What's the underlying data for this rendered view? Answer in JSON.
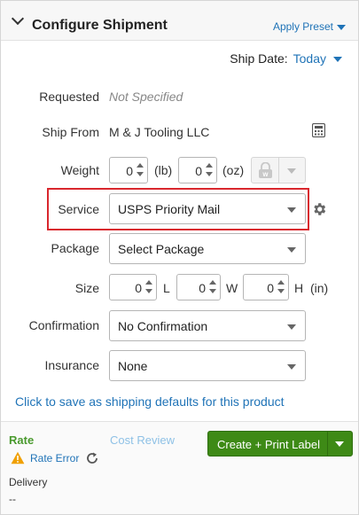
{
  "header": {
    "title": "Configure Shipment",
    "apply_preset": "Apply Preset"
  },
  "ship_date": {
    "label": "Ship Date:",
    "value": "Today"
  },
  "form": {
    "requested": {
      "label": "Requested",
      "value": "Not Specified"
    },
    "ship_from": {
      "label": "Ship From",
      "value": "M & J Tooling LLC",
      "icon": "calculator-icon"
    },
    "weight": {
      "label": "Weight",
      "lb": "0",
      "lb_unit": "(lb)",
      "oz": "0",
      "oz_unit": "(oz)",
      "scale_icon": "scale-lock-icon"
    },
    "service": {
      "label": "Service",
      "value": "USPS Priority Mail",
      "icon": "gear-icon"
    },
    "package": {
      "label": "Package",
      "value": "Select Package"
    },
    "size": {
      "label": "Size",
      "l": "0",
      "l_label": "L",
      "w": "0",
      "w_label": "W",
      "h": "0",
      "h_label": "H",
      "unit": "(in)"
    },
    "confirmation": {
      "label": "Confirmation",
      "value": "No Confirmation"
    },
    "insurance": {
      "label": "Insurance",
      "value": "None"
    }
  },
  "defaults_link": "Click to save as shipping defaults for this product",
  "footer": {
    "rate_label": "Rate",
    "cost_review": "Cost Review",
    "rate_error": "Rate Error",
    "delivery_label": "Delivery",
    "delivery_value": "--",
    "primary_button": "Create + Print Label"
  },
  "colors": {
    "link": "#1f73b7",
    "primary": "#3e8a16",
    "highlight": "#d9272e",
    "rate": "#4a9a2e",
    "warning": "#f0a000"
  }
}
